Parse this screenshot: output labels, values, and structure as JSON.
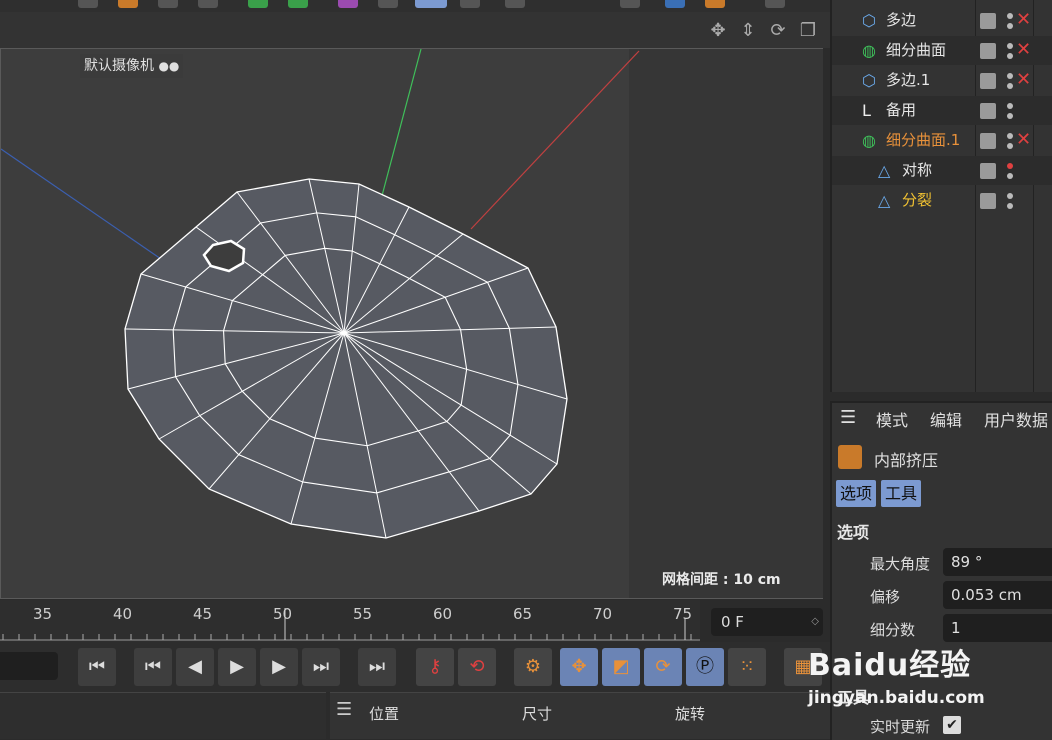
{
  "viewport": {
    "camera_label": "默认摄像机",
    "grid_spacing": "网格间距 : 10 cm"
  },
  "timeline": {
    "ticks": [
      "35",
      "40",
      "45",
      "50",
      "55",
      "60",
      "65",
      "70",
      "75"
    ],
    "current_frame": "0 F"
  },
  "coordinates": {
    "position": "位置",
    "size": "尺寸",
    "rotation": "旋转"
  },
  "objects": [
    {
      "name": "多边",
      "color": "normal"
    },
    {
      "name": "细分曲面",
      "color": "normal"
    },
    {
      "name": "多边.1",
      "color": "normal"
    },
    {
      "name": "备用",
      "color": "normal"
    },
    {
      "name": "细分曲面.1",
      "color": "orange"
    },
    {
      "name": "对称",
      "color": "normal"
    },
    {
      "name": "分裂",
      "color": "yellow"
    }
  ],
  "attributes": {
    "menu": [
      "模式",
      "编辑",
      "用户数据"
    ],
    "tool_name": "内部挤压",
    "tabs": [
      "选项",
      "工具"
    ],
    "section": "选项",
    "props": [
      {
        "label": "最大角度",
        "value": "89 °"
      },
      {
        "label": "偏移",
        "value": "0.053 cm"
      },
      {
        "label": "细分数",
        "value": "1"
      }
    ],
    "tool_section": "工具",
    "realtime_update": "实时更新",
    "realtime_checked": true
  },
  "watermark": {
    "brand": "Baidu经验",
    "url": "jingyan.baidu.com"
  },
  "colors": {
    "accent_blue": "#7c9ad1",
    "orange": "#e8913a",
    "yellow": "#f1c232",
    "red_x": "#e04040"
  }
}
